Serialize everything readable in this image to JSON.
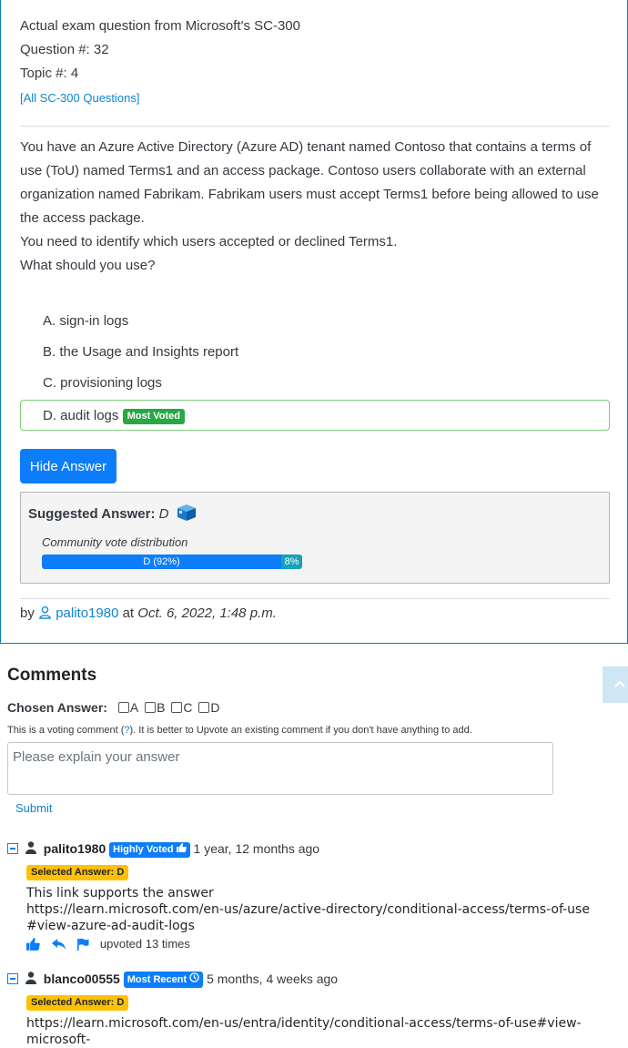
{
  "header": {
    "line1": "Actual exam question from Microsoft's SC-300",
    "question_num": "Question #: 32",
    "topic": "Topic #: 4",
    "all_questions_link": "[All SC-300 Questions]"
  },
  "question": {
    "paragraphs": [
      "You have an Azure Active Directory (Azure AD) tenant named Contoso that contains a terms of use (ToU) named Terms1 and an access package. Contoso users collaborate with an external organization named Fabrikam. Fabrikam users must accept Terms1 before being allowed to use the access package.",
      "You need to identify which users accepted or declined Terms1.",
      "What should you use?"
    ]
  },
  "choices": [
    {
      "text": "A. sign-in logs"
    },
    {
      "text": "B. the Usage and Insights report"
    },
    {
      "text": "C. provisioning logs"
    },
    {
      "text": "D. audit logs",
      "badge": "Most Voted"
    }
  ],
  "hide_answer_label": "Hide Answer",
  "suggested": {
    "label": "Suggested Answer:",
    "value": "D",
    "vote_label": "Community vote distribution",
    "bar_primary_label": "D (92%)",
    "bar_primary_pct": 92,
    "bar_secondary_label": "8%",
    "bar_secondary_pct": 8
  },
  "byline": {
    "by": "by",
    "user": "palito1980",
    "at": "at",
    "date": "Oct. 6, 2022, 1:48 p.m."
  },
  "comments_section": {
    "title": "Comments",
    "chosen_label": "Chosen Answer:",
    "options": [
      "A",
      "B",
      "C",
      "D"
    ],
    "note_pre": "This is a voting comment (",
    "note_link": "?",
    "note_post": "). It is better to Upvote an existing comment if you don't have anything to add.",
    "placeholder": "Please explain your answer",
    "submit": "Submit"
  },
  "comments": [
    {
      "user": "palito1980",
      "badge": "Highly Voted",
      "time": "1 year, 12 months ago",
      "selected": "Selected Answer: D",
      "lines": [
        "This link supports the answer",
        "https://learn.microsoft.com/en-us/azure/active-directory/conditional-access/terms-of-use#view-azure-ad-audit-logs"
      ],
      "upvoted": "upvoted 13 times"
    },
    {
      "user": "blanco00555",
      "badge": "Most Recent",
      "time": "5 months, 4 weeks ago",
      "selected": "Selected Answer: D",
      "lines": [
        "https://learn.microsoft.com/en-us/entra/identity/conditional-access/terms-of-use#view-microsoft-"
      ]
    }
  ],
  "colors": {
    "primary": "#0d7dfa",
    "success": "#28a745",
    "warning": "#ffc107",
    "info": "#17a2b8",
    "card_border": "#0d7fb7"
  }
}
